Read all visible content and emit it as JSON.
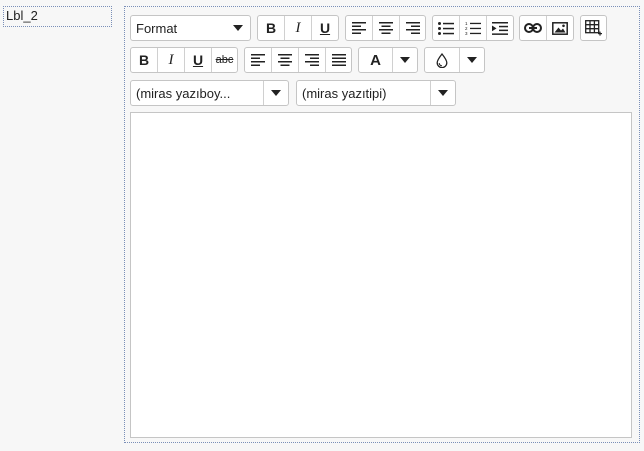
{
  "label": {
    "text": "Lbl_2"
  },
  "toolbar": {
    "format_select": {
      "value": "Format"
    },
    "bold": "B",
    "italic": "I",
    "underline": "U",
    "strikethrough": "abc",
    "font_color": "A",
    "font_size_select": {
      "value": "(miras yazıboy..."
    },
    "font_family_select": {
      "value": "(miras yazıtipi)"
    }
  },
  "icons": {
    "align_left": "align-left-icon",
    "align_center": "align-center-icon",
    "align_right": "align-right-icon",
    "align_justify": "align-justify-icon",
    "bullet_list": "bullet-list-icon",
    "numbered_list": "numbered-list-icon",
    "indent": "indent-icon",
    "link": "link-icon",
    "image": "image-icon",
    "table": "table-icon",
    "highlight": "highlight-drop-icon"
  },
  "colors": {
    "border": "#c5c5c5",
    "frame": "#7a8fb8",
    "background": "#f7f7f7"
  }
}
